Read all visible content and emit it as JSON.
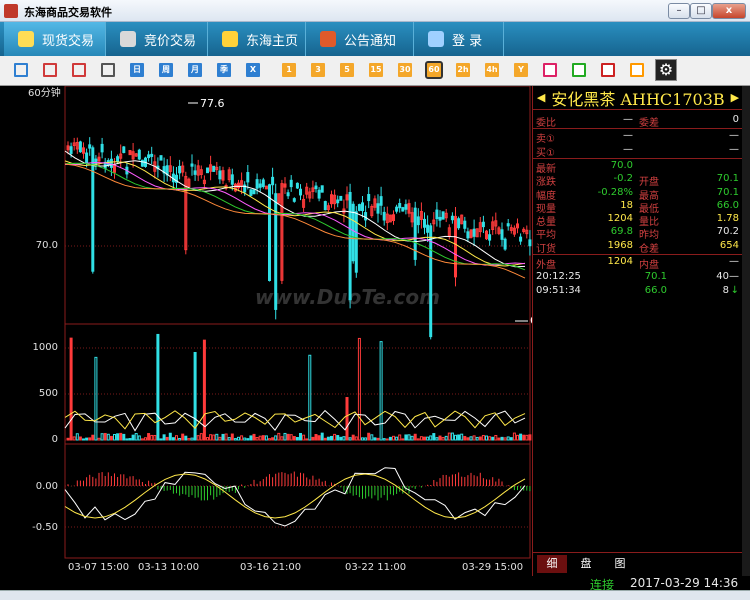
{
  "window": {
    "title": "东海商品交易软件"
  },
  "nav": [
    {
      "label": "现货交易",
      "active": true,
      "icon": "chart-icon",
      "color": "#ffdd55"
    },
    {
      "label": "竞价交易",
      "active": false,
      "icon": "hammer-icon",
      "color": "#d9d9d9"
    },
    {
      "label": "东海主页",
      "active": false,
      "icon": "yen-icon",
      "color": "#ffd23a"
    },
    {
      "label": "公告通知",
      "active": false,
      "icon": "speaker-icon",
      "color": "#e05a2a"
    },
    {
      "label": "登   录",
      "active": false,
      "icon": "user-icon",
      "color": "#9fd0ff"
    }
  ],
  "toolbar": {
    "icons": [
      "bar-chart-icon",
      "line-chart-icon",
      "candle-icon",
      "calendar-icon"
    ],
    "period_buttons": [
      "日",
      "周",
      "月",
      "季",
      "X"
    ],
    "minute_buttons": [
      "1",
      "3",
      "5",
      "15",
      "30",
      "60",
      "2h",
      "4h",
      "Y"
    ],
    "selected_minute": "60",
    "tool_icons": [
      "note-icon",
      "zoom-in-icon",
      "zoom-out-icon",
      "pen-icon"
    ]
  },
  "chart": {
    "period_label": "60分钟",
    "max_label": "77.6",
    "min_label": "66",
    "watermark": "www.DuoTe.com",
    "price_axis": [
      "70.0"
    ],
    "vol_axis": [
      "1000",
      "500",
      "0"
    ],
    "macd_axis": [
      "0.00",
      "-0.50"
    ],
    "x_labels": [
      "03-07 15:00",
      "03-13 10:00",
      "03-16 21:00",
      "03-22 11:00",
      "03-29 15:00"
    ]
  },
  "chart_data": {
    "type": "candlestick",
    "title": "60分钟",
    "x": [
      "03-07 15:00",
      "03-13 10:00",
      "03-16 21:00",
      "03-22 11:00",
      "03-29 15:00"
    ],
    "price_high": 77.6,
    "price_low": 66.0,
    "price_ref": 70.0,
    "volume_ylim": [
      0,
      1000
    ],
    "macd_ylim": [
      -0.5,
      0.0
    ]
  },
  "quote": {
    "name": "安化黑茶 AHHC1703B",
    "rows": [
      {
        "l1": "委比",
        "v1": "—",
        "l2": "委差",
        "v2": "0",
        "c1": "v-white",
        "c2": "v-white"
      },
      {
        "l1": "卖①",
        "v1": "—",
        "l2": "",
        "v2": "—",
        "c1": "v-white",
        "c2": "v-white"
      },
      {
        "l1": "买①",
        "v1": "—",
        "l2": "",
        "v2": "—",
        "c1": "v-white",
        "c2": "v-white"
      },
      {
        "l1": "最新",
        "v1": "70.0",
        "l2": "",
        "v2": "",
        "c1": "v-green",
        "c2": "v-white"
      },
      {
        "l1": "涨跌",
        "v1": "-0.2",
        "l2": "开盘",
        "v2": "70.1",
        "c1": "v-green",
        "c2": "v-green"
      },
      {
        "l1": "幅度",
        "v1": "-0.28%",
        "l2": "最高",
        "v2": "70.1",
        "c1": "v-green",
        "c2": "v-green"
      },
      {
        "l1": "现量",
        "v1": "18",
        "l2": "最低",
        "v2": "66.0",
        "c1": "v-yellow",
        "c2": "v-green"
      },
      {
        "l1": "总量",
        "v1": "1204",
        "l2": "量比",
        "v2": "1.78",
        "c1": "v-yellow",
        "c2": "v-yellow"
      },
      {
        "l1": "平均",
        "v1": "69.8",
        "l2": "昨均",
        "v2": "70.2",
        "c1": "v-green",
        "c2": "v-white"
      },
      {
        "l1": "订货",
        "v1": "1968",
        "l2": "仓差",
        "v2": "654",
        "c1": "v-yellow",
        "c2": "v-yellow"
      },
      {
        "l1": "外盘",
        "v1": "1204",
        "l2": "内盘",
        "v2": "—",
        "c1": "v-yellow",
        "c2": "v-white"
      }
    ],
    "ticks": [
      {
        "time": "20:12:25",
        "price": "70.1",
        "vol": "40",
        "dir": "—"
      },
      {
        "time": "09:51:34",
        "price": "66.0",
        "vol": "8",
        "dir": "↓"
      }
    ],
    "tabs": [
      "细",
      "盘",
      "图"
    ]
  },
  "status": {
    "connection": "连接",
    "datetime": "2017-03-29 14:36"
  }
}
